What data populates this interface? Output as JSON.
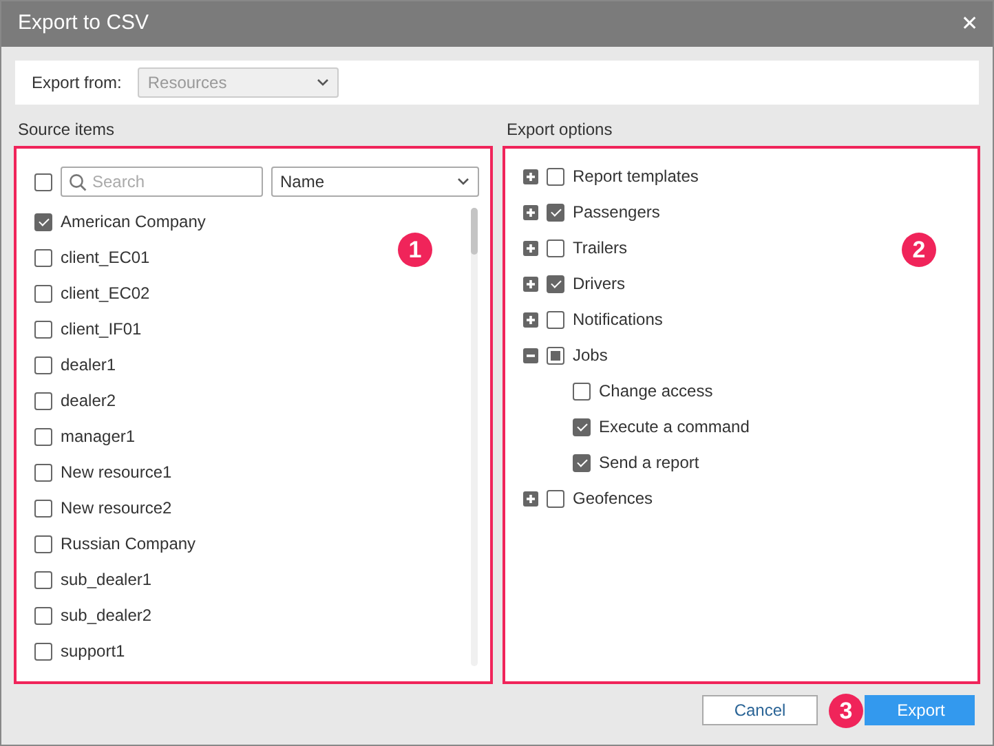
{
  "window": {
    "title": "Export to CSV",
    "close": "✕"
  },
  "export_from": {
    "label": "Export from:",
    "value": "Resources",
    "disabled": true
  },
  "source_items": {
    "title": "Source items",
    "callout": "1",
    "select_all_checked": false,
    "search": {
      "placeholder": "Search"
    },
    "sort": {
      "value": "Name"
    },
    "items": [
      {
        "label": "American Company",
        "checked": true
      },
      {
        "label": "client_EC01",
        "checked": false
      },
      {
        "label": "client_EC02",
        "checked": false
      },
      {
        "label": "client_IF01",
        "checked": false
      },
      {
        "label": "dealer1",
        "checked": false
      },
      {
        "label": "dealer2",
        "checked": false
      },
      {
        "label": "manager1",
        "checked": false
      },
      {
        "label": "New resource1",
        "checked": false
      },
      {
        "label": "New resource2",
        "checked": false
      },
      {
        "label": "Russian Company",
        "checked": false
      },
      {
        "label": "sub_dealer1",
        "checked": false
      },
      {
        "label": "sub_dealer2",
        "checked": false
      },
      {
        "label": "support1",
        "checked": false
      }
    ]
  },
  "export_options": {
    "title": "Export options",
    "callout": "2",
    "items": [
      {
        "label": "Report templates",
        "checked": false,
        "partial": false,
        "expanded": false
      },
      {
        "label": "Passengers",
        "checked": true,
        "partial": false,
        "expanded": false
      },
      {
        "label": "Trailers",
        "checked": false,
        "partial": false,
        "expanded": false
      },
      {
        "label": "Drivers",
        "checked": true,
        "partial": false,
        "expanded": false
      },
      {
        "label": "Notifications",
        "checked": false,
        "partial": false,
        "expanded": false
      },
      {
        "label": "Jobs",
        "checked": false,
        "partial": true,
        "expanded": true,
        "children": [
          {
            "label": "Change access",
            "checked": false
          },
          {
            "label": "Execute a command",
            "checked": true
          },
          {
            "label": "Send a report",
            "checked": true
          }
        ]
      },
      {
        "label": "Geofences",
        "checked": false,
        "partial": false,
        "expanded": false
      }
    ]
  },
  "buttons": [
    {
      "label": "Cancel",
      "kind": "secondary"
    },
    {
      "label": "Export",
      "kind": "primary",
      "callout": "3"
    }
  ]
}
